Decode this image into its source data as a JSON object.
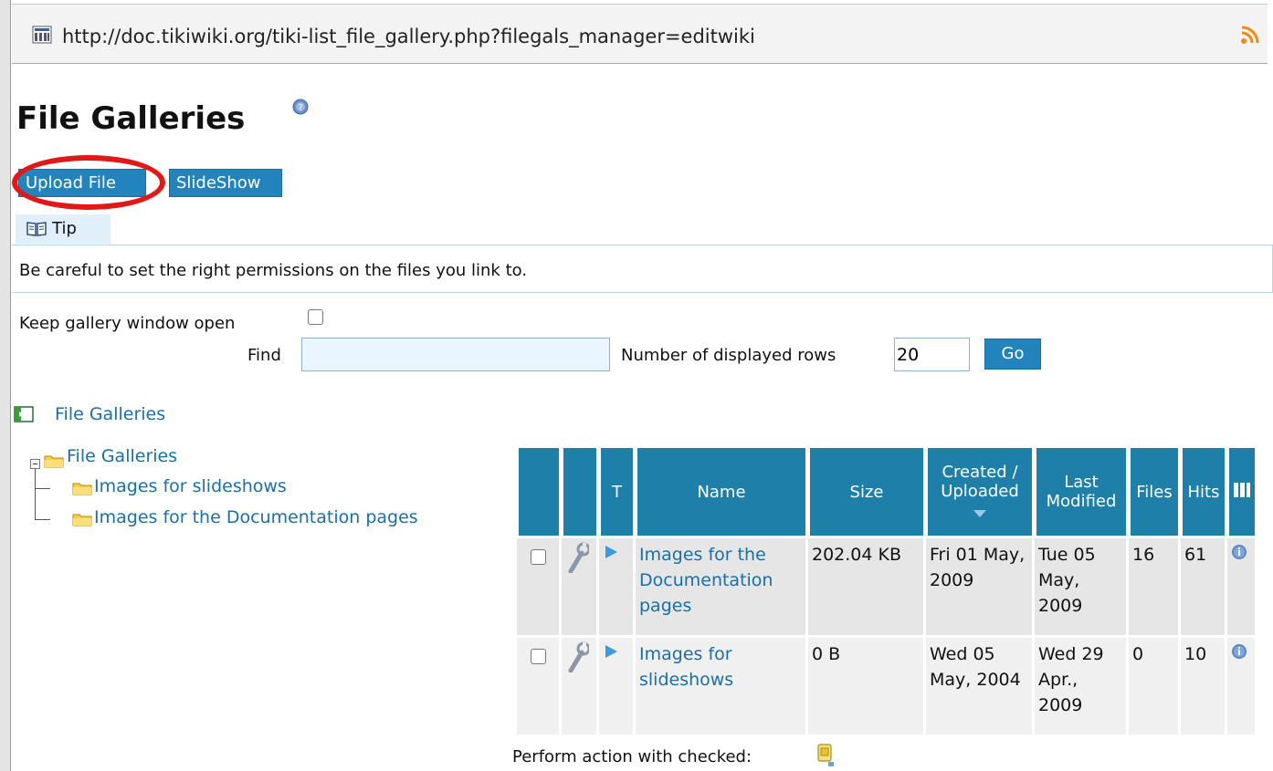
{
  "browser": {
    "url": "http://doc.tikiwiki.org/tiki-list_file_gallery.php?filegals_manager=editwiki",
    "site_icon": "tikiwiki-favicon",
    "rss_icon": "rss-feed-icon"
  },
  "page": {
    "title": "File Galleries",
    "help_icon": "help-icon"
  },
  "toolbar": {
    "upload_label": "Upload File",
    "slideshow_label": "SlideShow",
    "highlight_color": "#e01818"
  },
  "tip": {
    "tab_label": "Tip",
    "text": "Be careful to set the right permissions on the files you link to."
  },
  "options": {
    "keep_open_label": "Keep gallery window open",
    "keep_open_checked": false,
    "find_label": "Find",
    "find_value": "",
    "rows_label": "Number of displayed rows",
    "rows_value": "20",
    "go_label": "Go"
  },
  "nav": {
    "back_link": "File Galleries"
  },
  "tree": {
    "root": "File Galleries",
    "children": [
      "Images for slideshows",
      "Images for the Documentation pages"
    ]
  },
  "table": {
    "headers": {
      "type": "T",
      "name": "Name",
      "size": "Size",
      "created": "Created / Uploaded",
      "modified": "Last Modified",
      "files": "Files",
      "hits": "Hits"
    },
    "rows": [
      {
        "name": "Images for the Documentation pages",
        "size": "202.04 KB",
        "created": "Fri 01 May, 2009",
        "modified": "Tue 05 May, 2009",
        "files": "16",
        "hits": "61"
      },
      {
        "name": "Images for slideshows",
        "size": "0 B",
        "created": "Wed 05 May, 2004",
        "modified": "Wed 29 Apr., 2009",
        "files": "0",
        "hits": "10"
      }
    ]
  },
  "footer": {
    "perform_label": "Perform action with checked:"
  },
  "colors": {
    "accent": "#2383bd",
    "header_bg": "#1e7fa8",
    "link": "#1b6ea8",
    "tip_bg": "#e1effa"
  }
}
